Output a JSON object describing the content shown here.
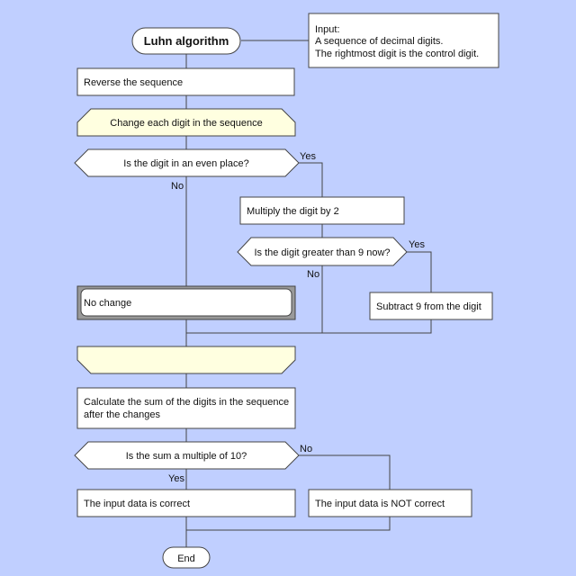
{
  "diagram": {
    "title": "Luhn algorithm",
    "background_color": "#c0cfff",
    "nodes": {
      "start": {
        "type": "terminator",
        "label": "Luhn algorithm"
      },
      "comment": {
        "type": "comment",
        "lines": [
          "Input:",
          "A sequence of decimal digits.",
          "The rightmost digit is the control digit."
        ]
      },
      "reverse": {
        "type": "process",
        "label": "Reverse the sequence"
      },
      "loop_start": {
        "type": "loop-begin",
        "label": "Change each digit in the sequence",
        "fill": "#ffffe0"
      },
      "even_place": {
        "type": "decision",
        "label": "Is the digit in an even place?"
      },
      "multiply": {
        "type": "process",
        "label": "Multiply the digit by 2"
      },
      "greater_9": {
        "type": "decision",
        "label": "Is the digit greater than 9 now?"
      },
      "subtract": {
        "type": "process",
        "label": "Subtract 9 from the digit"
      },
      "no_change": {
        "type": "predefined",
        "label": "No change"
      },
      "loop_end": {
        "type": "loop-end",
        "label": "",
        "fill": "#ffffe0"
      },
      "sum": {
        "type": "process",
        "lines": [
          "Calculate the sum of the digits in the sequence",
          "after the changes"
        ]
      },
      "multiple_10": {
        "type": "decision",
        "label": "Is the sum a multiple of 10?"
      },
      "correct": {
        "type": "process",
        "label": "The input data is correct"
      },
      "not_correct": {
        "type": "process",
        "label": "The input data is NOT correct"
      },
      "end": {
        "type": "terminator",
        "label": "End"
      }
    },
    "edge_labels": {
      "even_yes": "Yes",
      "even_no": "No",
      "greater_yes": "Yes",
      "greater_no": "No",
      "mult_no": "No",
      "mult_yes": "Yes"
    }
  }
}
